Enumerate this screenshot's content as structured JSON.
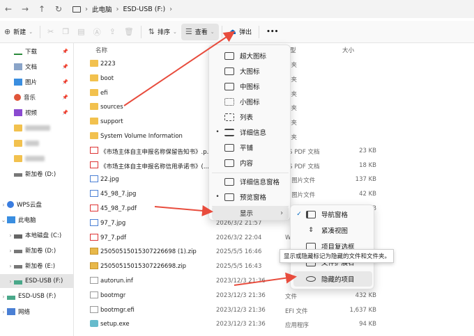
{
  "nav": {
    "breadcrumb": [
      "此电脑",
      "ESD-USB (F:)"
    ]
  },
  "toolbar": {
    "new_label": "新建",
    "sort_label": "排序",
    "view_label": "查看",
    "eject_label": "弹出",
    "more_label": "•••"
  },
  "sidebar": {
    "items": [
      {
        "label": "下载",
        "pinned": true
      },
      {
        "label": "文档",
        "pinned": true
      },
      {
        "label": "图片",
        "pinned": true
      },
      {
        "label": "音乐",
        "pinned": true
      },
      {
        "label": "视频",
        "pinned": true
      },
      {
        "label": "新加卷 (D:)"
      },
      {
        "label": "WPS云盘"
      },
      {
        "label": "此电脑"
      },
      {
        "label": "本地磁盘 (C:)"
      },
      {
        "label": "新加卷 (D:)"
      },
      {
        "label": "新加卷 (E:)"
      },
      {
        "label": "ESD-USB (F:)"
      },
      {
        "label": "ESD-USB (F:)"
      },
      {
        "label": "网络"
      }
    ]
  },
  "columns": {
    "name": "名称",
    "type": "型",
    "size": "大小"
  },
  "files": [
    {
      "name": "2223",
      "date": "",
      "type": "件夹",
      "size": ""
    },
    {
      "name": "boot",
      "date": "",
      "type": "件夹",
      "size": ""
    },
    {
      "name": "efi",
      "date": "",
      "type": "件夹",
      "size": ""
    },
    {
      "name": "sources",
      "date": "",
      "type": "件夹",
      "size": ""
    },
    {
      "name": "support",
      "date": "",
      "type": "件夹",
      "size": ""
    },
    {
      "name": "System Volume Information",
      "date": "",
      "type": "件夹",
      "size": ""
    },
    {
      "name": "《市场主体自主申报名称保留告知书》.p...",
      "date": "",
      "type": "PS PDF 文档",
      "size": "23 KB"
    },
    {
      "name": "《市场主体自主申报名称信用承诺书》(...",
      "date": "",
      "type": "PS PDF 文档",
      "size": "18 KB"
    },
    {
      "name": "22.jpg",
      "date": "",
      "type": "G 图片文件",
      "size": "137 KB"
    },
    {
      "name": "45_98_7.jpg",
      "date": "",
      "type": "G 图片文件",
      "size": "42 KB"
    },
    {
      "name": "45_98_7.pdf",
      "date": "",
      "type": "S PDF 文档",
      "size": "25 KB"
    },
    {
      "name": "97_7.jpg",
      "date": "2026/3/2 21:57",
      "type": "",
      "size": ""
    },
    {
      "name": "97_7.pdf",
      "date": "2026/3/2 22:04",
      "type": "W",
      "size": ""
    },
    {
      "name": "25050515015307226698 (1).zip",
      "date": "2025/5/5 16:46",
      "type": "",
      "size": ""
    },
    {
      "name": "25050515015307226698.zip",
      "date": "2025/5/5 16:43",
      "type": "",
      "size": ""
    },
    {
      "name": "autorun.inf",
      "date": "2023/12/3 21:36",
      "type": "",
      "size": ""
    },
    {
      "name": "bootmgr",
      "date": "2023/12/3 21:36",
      "type": "文件",
      "size": "432 KB"
    },
    {
      "name": "bootmgr.efi",
      "date": "2023/12/3 21:36",
      "type": "EFI 文件",
      "size": "1,637 KB"
    },
    {
      "name": "setup.exe",
      "date": "2023/12/3 21:36",
      "type": "应用程序",
      "size": "94 KB"
    }
  ],
  "view_menu": {
    "items": [
      "超大图标",
      "大图标",
      "中图标",
      "小图标",
      "列表",
      "详细信息",
      "平铺",
      "内容",
      "详细信息窗格",
      "预览窗格",
      "显示"
    ]
  },
  "show_submenu": {
    "items": [
      "导航窗格",
      "紧凑视图",
      "项目复选框",
      "文件扩展名",
      "隐藏的项目"
    ]
  },
  "tooltip": "显示或隐藏标记为隐藏的文件和文件夹。",
  "colors": {
    "accent": "#0067c0",
    "arrow": "#e84c3d",
    "folder": "#f2c14e"
  }
}
